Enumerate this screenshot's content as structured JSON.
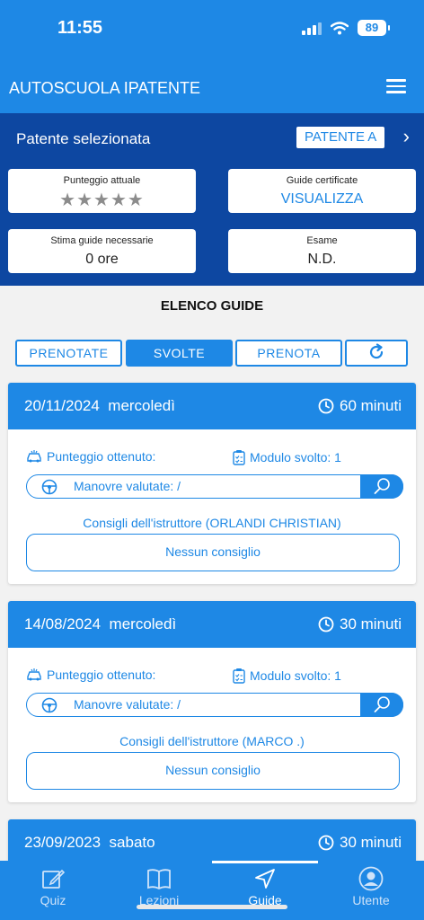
{
  "status": {
    "time": "11:55",
    "battery": "89"
  },
  "header": {
    "title": "AUTOSCUOLA IPATENTE"
  },
  "selection": {
    "label": "Patente selezionata",
    "value": "PATENTE A",
    "cards": {
      "score": {
        "label": "Punteggio attuale",
        "stars_total": 5,
        "stars_filled": 0
      },
      "certified": {
        "label": "Guide certificate",
        "action": "VISUALIZZA"
      },
      "estimate": {
        "label": "Stima guide necessarie",
        "value": "0 ore"
      },
      "exam": {
        "label": "Esame",
        "value": "N.D."
      }
    }
  },
  "list": {
    "title": "ELENCO GUIDE",
    "tabs": [
      "PRENOTATE",
      "SVOLTE",
      "PRENOTA"
    ],
    "active_tab": "SVOLTE"
  },
  "guides": [
    {
      "date": "20/11/2024",
      "day": "mercoledì",
      "duration": "60 minuti",
      "score_label": "Punteggio ottenuto:",
      "module": "Modulo svolto: 1",
      "maneuvers": "Manovre valutate: /",
      "advice_label": "Consigli dell'istruttore (ORLANDI CHRISTIAN)",
      "advice": "Nessun consiglio"
    },
    {
      "date": "14/08/2024",
      "day": "mercoledì",
      "duration": "30 minuti",
      "score_label": "Punteggio ottenuto:",
      "module": "Modulo svolto: 1",
      "maneuvers": "Manovre valutate: /",
      "advice_label": "Consigli dell'istruttore (MARCO .)",
      "advice": "Nessun consiglio"
    },
    {
      "date": "23/09/2023",
      "day": "sabato",
      "duration": "30 minuti"
    }
  ],
  "nav": {
    "items": [
      "Quiz",
      "Lezioni",
      "Guide",
      "Utente"
    ],
    "active": "Guide"
  },
  "colors": {
    "primary": "#1e88e5",
    "panel": "#0d47a1",
    "background": "#f2f2f2"
  }
}
